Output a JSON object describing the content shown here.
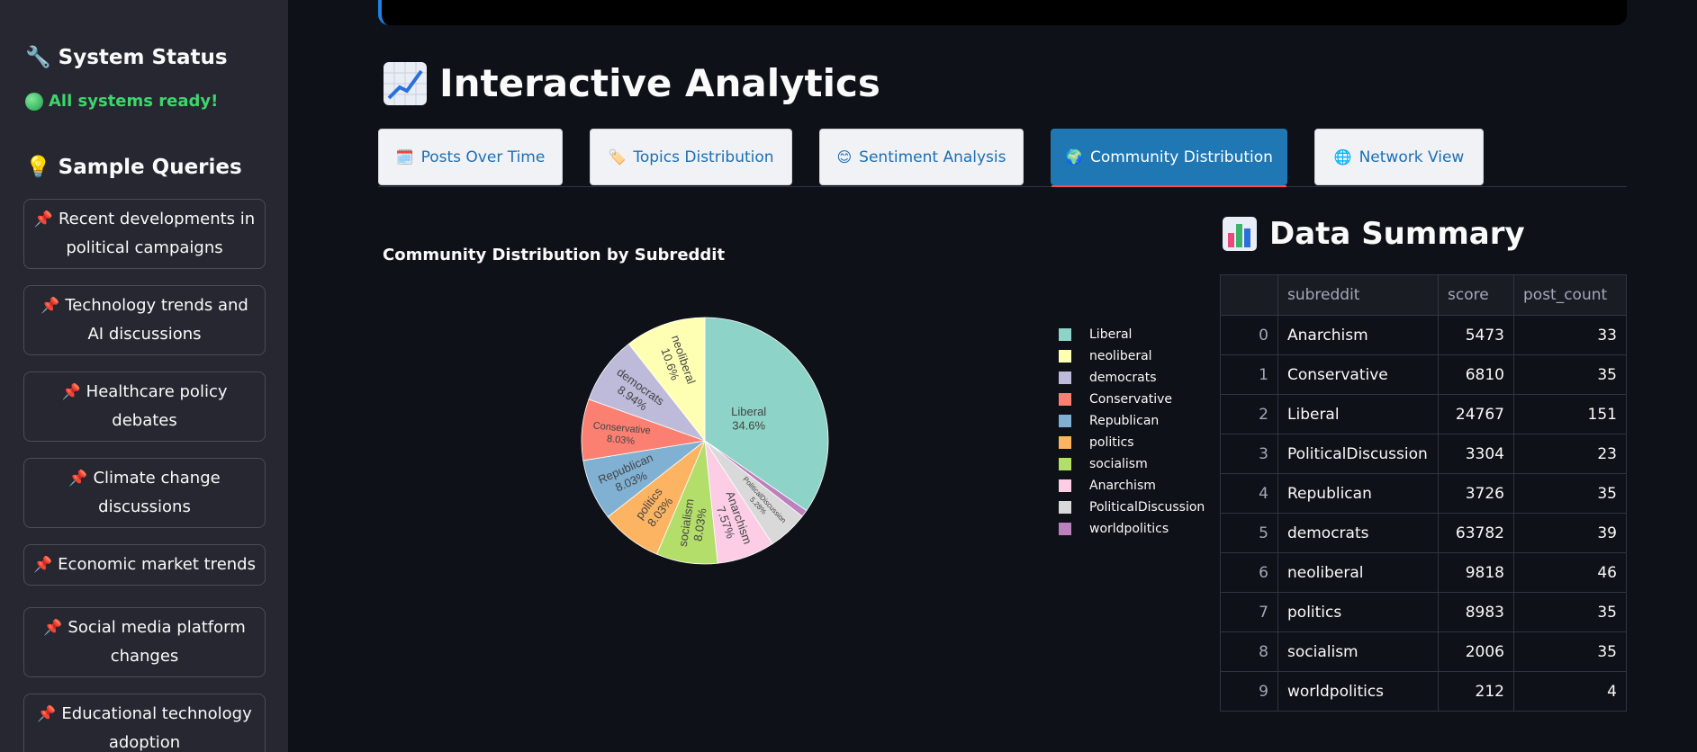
{
  "sidebar": {
    "status_title": "🔧 System Status",
    "status_text": "All systems ready!",
    "queries_title": "💡 Sample Queries",
    "queries": [
      "Recent developments in political campaigns",
      "Technology trends and AI discussions",
      "Healthcare policy debates",
      "Climate change discussions",
      "Economic market trends",
      "Social media platform changes",
      "Educational technology adoption"
    ]
  },
  "main": {
    "title": "Interactive Analytics",
    "tabs": [
      {
        "label": "Posts Over Time",
        "icon": "calendar-icon"
      },
      {
        "label": "Topics Distribution",
        "icon": "tag-icon"
      },
      {
        "label": "Sentiment Analysis",
        "icon": "smile-icon"
      },
      {
        "label": "Community Distribution",
        "icon": "globe-icon",
        "active": true
      },
      {
        "label": "Network View",
        "icon": "network-icon"
      }
    ]
  },
  "chart_data": {
    "type": "pie",
    "title": "Community Distribution by Subreddit",
    "slices": [
      {
        "label": "Liberal",
        "value": 34.6,
        "color": "#8dd3c7"
      },
      {
        "label": "worldpolitics",
        "value": 0.92,
        "color": "#bc80bd"
      },
      {
        "label": "PoliticalDiscussion",
        "value": 5.28,
        "color": "#d9d9d9"
      },
      {
        "label": "Anarchism",
        "value": 7.57,
        "color": "#fccde5"
      },
      {
        "label": "socialism",
        "value": 8.03,
        "color": "#b3de69"
      },
      {
        "label": "politics",
        "value": 8.03,
        "color": "#fdb462"
      },
      {
        "label": "Republican",
        "value": 8.03,
        "color": "#80b1d3"
      },
      {
        "label": "Conservative",
        "value": 8.03,
        "color": "#fb8072"
      },
      {
        "label": "democrats",
        "value": 8.94,
        "color": "#bebada"
      },
      {
        "label": "neoliberal",
        "value": 10.6,
        "color": "#ffffb3"
      }
    ],
    "slice_labels": [
      {
        "label": "Liberal",
        "pct": "34.6%"
      },
      {
        "label": "PoliticalDiscussion",
        "pct": "5.28%"
      },
      {
        "label": "Anarchism",
        "pct": "7.57%"
      },
      {
        "label": "socialism",
        "pct": "8.03%"
      },
      {
        "label": "politics",
        "pct": "8.03%"
      },
      {
        "label": "Republican",
        "pct": "8.03%"
      },
      {
        "label": "Conservative",
        "pct": "8.03%"
      },
      {
        "label": "democrats",
        "pct": "8.94%"
      },
      {
        "label": "neoliberal",
        "pct": "10.6%"
      }
    ],
    "legend": [
      {
        "label": "Liberal",
        "color": "#8dd3c7"
      },
      {
        "label": "neoliberal",
        "color": "#ffffb3"
      },
      {
        "label": "democrats",
        "color": "#bebada"
      },
      {
        "label": "Conservative",
        "color": "#fb8072"
      },
      {
        "label": "Republican",
        "color": "#80b1d3"
      },
      {
        "label": "politics",
        "color": "#fdb462"
      },
      {
        "label": "socialism",
        "color": "#b3de69"
      },
      {
        "label": "Anarchism",
        "color": "#fccde5"
      },
      {
        "label": "PoliticalDiscussion",
        "color": "#d9d9d9"
      },
      {
        "label": "worldpolitics",
        "color": "#bc80bd"
      }
    ]
  },
  "summary": {
    "title": "Data Summary",
    "columns": [
      "",
      "subreddit",
      "score",
      "post_count"
    ],
    "rows": [
      [
        "0",
        "Anarchism",
        "5473",
        "33"
      ],
      [
        "1",
        "Conservative",
        "6810",
        "35"
      ],
      [
        "2",
        "Liberal",
        "24767",
        "151"
      ],
      [
        "3",
        "PoliticalDiscussion",
        "3304",
        "23"
      ],
      [
        "4",
        "Republican",
        "3726",
        "35"
      ],
      [
        "5",
        "democrats",
        "63782",
        "39"
      ],
      [
        "6",
        "neoliberal",
        "9818",
        "46"
      ],
      [
        "7",
        "politics",
        "8983",
        "35"
      ],
      [
        "8",
        "socialism",
        "2006",
        "35"
      ],
      [
        "9",
        "worldpolitics",
        "212",
        "4"
      ]
    ]
  }
}
